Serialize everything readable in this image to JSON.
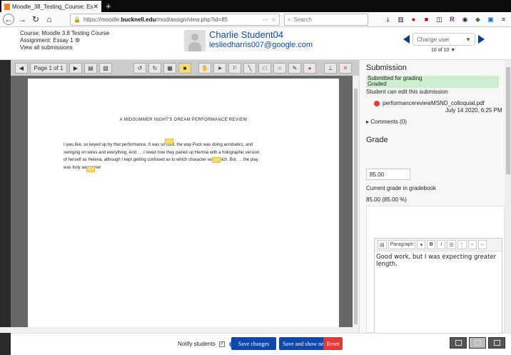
{
  "browser": {
    "tab_title": "Moodle_38_Testing_Course: Es",
    "tab_close": "✕",
    "new_tab": "+",
    "url_prefix": "https://moodle.",
    "url_domain": "bucknell.edu",
    "url_suffix": "/mod/assign/view.php?id=85",
    "search_placeholder": "Search"
  },
  "header": {
    "course": "Course: Moodle 3.8 Testing Course",
    "assignment": "Assignment: Essay 1",
    "view_all": "View all submissions",
    "student_name": "Charlie Student04",
    "student_email": "lesliedharris007@google.com",
    "change_user": "Change user",
    "count": "10 of 10"
  },
  "editor": {
    "page_label": "Page 1 of 1",
    "doc_title": "A MIDSUMMER NIGHT'S DREAM PERFORMANCE REVIEW",
    "doc_line1": "I was,like, so keyed up by that performance.  It was so cool, the way Puck was doing acrobatics, and",
    "doc_line2": "swinging on wires and everything.  And . . .I loved how they paired up Hermia with a holographic version",
    "doc_line3": "of herself as Helena, although I kept getting confused as to which character was which.  But . . .the play",
    "doc_line4": "was truly awesome!"
  },
  "panel": {
    "submission_heading": "Submission",
    "status1": "Submitted for grading",
    "status2": "Graded",
    "can_edit": "Student can edit this submission",
    "file_name": "performancereviewMSND_colloquial.pdf",
    "file_date": "July 14 2020, 6:25 PM",
    "comments": "Comments (0)",
    "grade_heading": "Grade",
    "grade_value": "85.00",
    "current_label": "Current grade in gradebook",
    "current_value": "85.00 (85.00 %)",
    "format_select": "Paragraph",
    "feedback": "Good work, but I was expecting greater length."
  },
  "footer": {
    "notify": "Notify students",
    "save": "Save changes",
    "save_next": "Save and show next",
    "reset": "Reset"
  }
}
